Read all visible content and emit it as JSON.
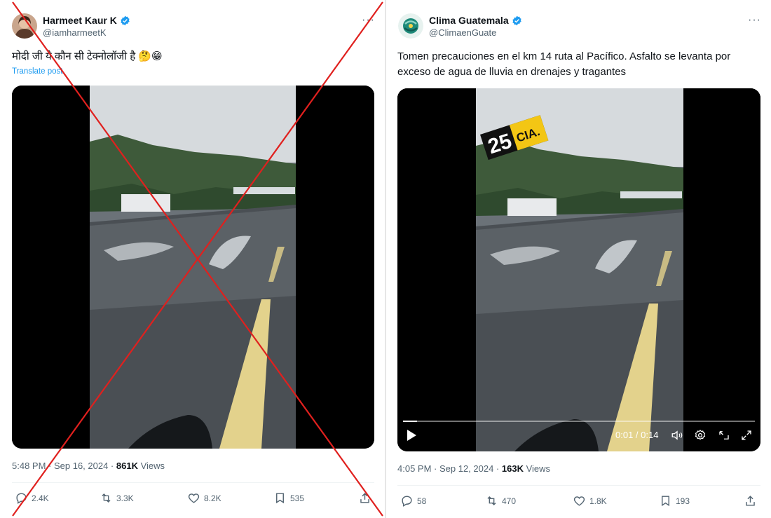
{
  "left_tweet": {
    "display_name": "Harmeet Kaur K",
    "handle": "@iamharmeetK",
    "more_icon": "more-dots-icon",
    "text": "मोदी जी ये कौन सी टेक्नोलॉजी है 🤔😁",
    "translate_label": "Translate post",
    "timestamp": "5:48 PM · Sep 16, 2024 · ",
    "views_count": "861K",
    "views_label": " Views",
    "actions": {
      "reply": {
        "icon": "reply-icon",
        "count": "2.4K"
      },
      "repost": {
        "icon": "repost-icon",
        "count": "3.3K"
      },
      "like": {
        "icon": "heart-icon",
        "count": "8.2K"
      },
      "bookmark": {
        "icon": "bookmark-icon",
        "count": "535"
      },
      "share": {
        "icon": "share-icon"
      }
    },
    "marked_false": true,
    "strike_color": "#e0201e"
  },
  "right_tweet": {
    "display_name": "Clima Guatemala",
    "handle": "@ClimaenGuate",
    "more_icon": "more-dots-icon",
    "text": "Tomen precauciones en el km 14 ruta al Pacífico.  Asfalto se levanta por exceso de agua de lluvia en drenajes y tragantes",
    "video_badge_number": "25",
    "video_badge_text": "CIA.",
    "video_time": "0:01 / 0:14",
    "video_progress": 0.04,
    "timestamp": "4:05 PM · Sep 12, 2024 · ",
    "views_count": "163K",
    "views_label": " Views",
    "actions": {
      "reply": {
        "icon": "reply-icon",
        "count": "58"
      },
      "repost": {
        "icon": "repost-icon",
        "count": "470"
      },
      "like": {
        "icon": "heart-icon",
        "count": "1.8K"
      },
      "bookmark": {
        "icon": "bookmark-icon",
        "count": "193"
      },
      "share": {
        "icon": "share-icon"
      }
    }
  },
  "colors": {
    "verified_blue": "#1d9bf0",
    "muted_text": "#536471",
    "lane_marking": "#e3d28c"
  }
}
